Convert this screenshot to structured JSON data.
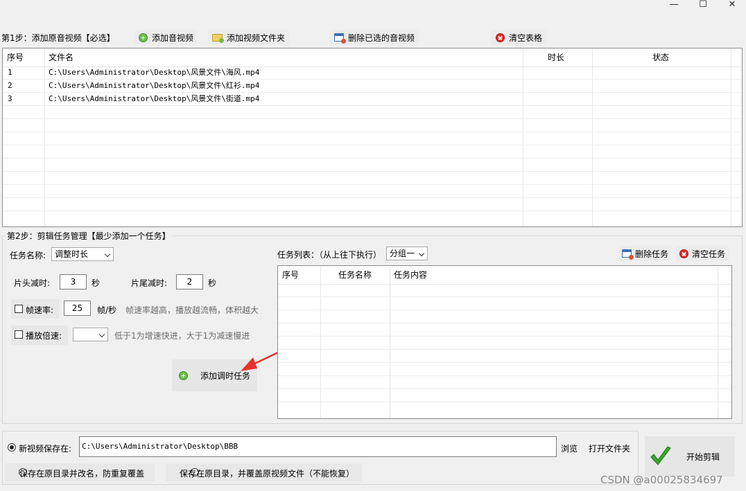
{
  "window": {
    "minimize": "—",
    "maximize": "☐",
    "close": "✕"
  },
  "step1": {
    "label": "第1步：添加原音视频【必选】",
    "buttons": {
      "add_media": "添加音视频",
      "add_folder": "添加视频文件夹",
      "delete_selected": "删除已选的音视频",
      "clear_table": "清空表格"
    }
  },
  "file_table": {
    "columns": [
      "序号",
      "文件名",
      "时长",
      "状态"
    ],
    "rows": [
      {
        "index": "1",
        "file": "C:\\Users\\Administrator\\Desktop\\风景文件\\海风.mp4",
        "duration": "",
        "status": ""
      },
      {
        "index": "2",
        "file": "C:\\Users\\Administrator\\Desktop\\风景文件\\红衫.mp4",
        "duration": "",
        "status": ""
      },
      {
        "index": "3",
        "file": "C:\\Users\\Administrator\\Desktop\\风景文件\\街道.mp4",
        "duration": "",
        "status": ""
      }
    ]
  },
  "step2": {
    "label": "第2步：剪辑任务管理【最少添加一个任务】",
    "task_name_label": "任务名称:",
    "task_name_value": "调整时长",
    "head_cut_label": "片头减时:",
    "head_cut_value": "3",
    "tail_cut_label": "片尾减时:",
    "tail_cut_value": "2",
    "seconds_unit": "秒",
    "fps_label": "帧速率:",
    "fps_value": "25",
    "fps_unit": "帧/秒",
    "fps_hint": "帧速率越高，播放越流畅，体积越大",
    "speed_label": "播放倍速:",
    "speed_value": "",
    "speed_hint": "低于1为增速快进，大于1为减速慢进",
    "add_task_button": "添加调时任务",
    "task_list_label": "任务列表：（从上往下执行）",
    "group_value": "分组一",
    "delete_task": "删除任务",
    "clear_tasks": "清空任务",
    "task_columns": [
      "序号",
      "任务名称",
      "任务内容"
    ]
  },
  "output": {
    "save_new_label": "新视频保存在:",
    "save_path": "C:\\Users\\Administrator\\Desktop\\BBB",
    "browse": "浏览",
    "open_folder": "打开文件夹",
    "option_rename": "保存在原目录并改名，防重复覆盖",
    "option_overwrite": "保存在原目录，并覆盖原视频文件（不能恢复）",
    "start_button": "开始剪辑"
  },
  "watermark": "CSDN @a00025834697",
  "colors": {
    "accent_green": "#3aa52e",
    "arrow_red": "#e8312c"
  }
}
